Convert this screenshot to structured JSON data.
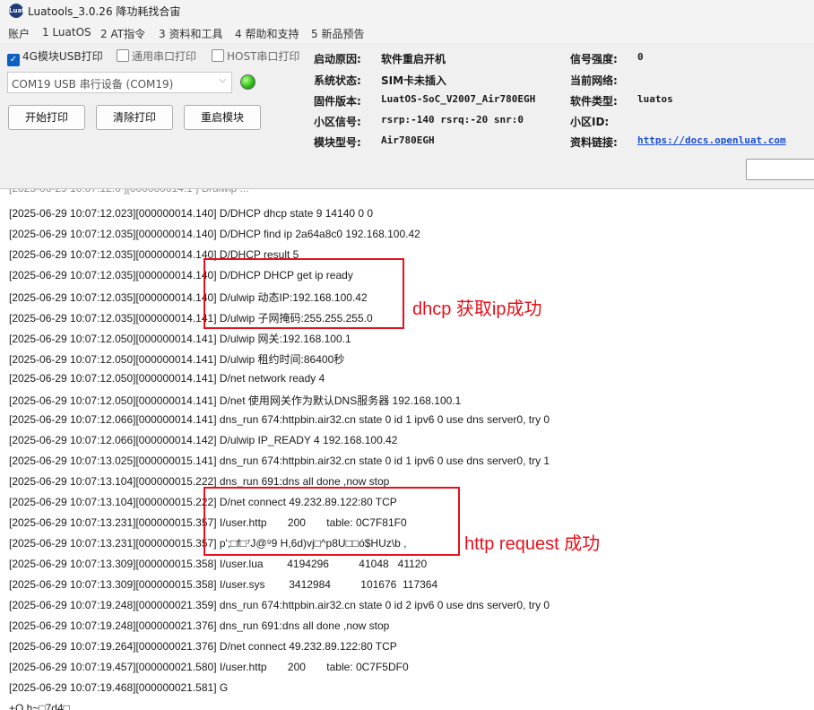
{
  "window": {
    "logo": "Luat",
    "title": "Luatools_3.0.26 降功耗找合宙"
  },
  "menu": [
    "账户",
    "1 LuatOS",
    "2 AT指令",
    "3 资料和工具",
    "4 帮助和支持",
    "5 新品预告"
  ],
  "checkboxes": [
    {
      "label": "4G模块USB打印",
      "checked": true
    },
    {
      "label": "通用串口打印",
      "checked": false
    },
    {
      "label": "HOST串口打印",
      "checked": false
    }
  ],
  "port_select": {
    "value": "COM19 USB 串行设备 (COM19)"
  },
  "status_led": {
    "color": "#2fbf1a"
  },
  "buttons": {
    "start_print": "开始打印",
    "clear_print": "清除打印",
    "restart_module": "重启模块"
  },
  "info": {
    "boot_reason_label": "启动原因:",
    "boot_reason_value": "软件重启开机",
    "system_status_label": "系统状态:",
    "system_status_value": "SIM卡未插入",
    "firmware_label": "固件版本:",
    "firmware_value": "LuatOS-SoC_V2007_Air780EGH",
    "cell_signal_label": "小区信号:",
    "cell_signal_value": "rsrp:-140 rsrq:-20 snr:0",
    "module_model_label": "模块型号:",
    "module_model_value": "Air780EGH",
    "signal_strength_label": "信号强度:",
    "signal_strength_value": "0",
    "network_label": "当前网络:",
    "network_value": "",
    "software_type_label": "软件类型:",
    "software_type_value": "luatos",
    "cell_id_label": "小区ID:",
    "cell_id_value": "",
    "docs_label": "资料链接:",
    "docs_value": "https://docs.openluat.com"
  },
  "search": {
    "placeholder": ""
  },
  "log": [
    "[2025-06-29 10:07:12.023][000000014.140] D/DHCP dhcp state 9 14140 0 0",
    "[2025-06-29 10:07:12.035][000000014.140] D/DHCP find ip 2a64a8c0 192.168.100.42",
    "[2025-06-29 10:07:12.035][000000014.140] D/DHCP result 5",
    "[2025-06-29 10:07:12.035][000000014.140] D/DHCP DHCP get ip ready",
    "[2025-06-29 10:07:12.035][000000014.140] D/ulwip 动态IP:192.168.100.42",
    "[2025-06-29 10:07:12.035][000000014.141] D/ulwip 子网掩码:255.255.255.0",
    "[2025-06-29 10:07:12.050][000000014.141] D/ulwip 网关:192.168.100.1",
    "[2025-06-29 10:07:12.050][000000014.141] D/ulwip 租约时间:86400秒",
    "[2025-06-29 10:07:12.050][000000014.141] D/net network ready 4",
    "[2025-06-29 10:07:12.050][000000014.141] D/net 使用网关作为默认DNS服务器 192.168.100.1",
    "[2025-06-29 10:07:12.066][000000014.141] dns_run 674:httpbin.air32.cn state 0 id 1 ipv6 0 use dns server0, try 0",
    "[2025-06-29 10:07:12.066][000000014.142] D/ulwip IP_READY 4 192.168.100.42",
    "[2025-06-29 10:07:13.025][000000015.141] dns_run 674:httpbin.air32.cn state 0 id 1 ipv6 0 use dns server0, try 1",
    "[2025-06-29 10:07:13.104][000000015.222] dns_run 691:dns all done ,now stop",
    "[2025-06-29 10:07:13.104][000000015.222] D/net connect 49.232.89.122:80 TCP",
    "[2025-06-29 10:07:13.231][000000015.357] I/user.http       200       table: 0C7F81F0",
    "[2025-06-29 10:07:13.231][000000015.357] p';□f□⁷J@⁹9 H,6d)vj□^p8U□□ó$HUz\\b ,",
    "[2025-06-29 10:07:13.309][000000015.358] I/user.lua        4194296          41048   41120",
    "[2025-06-29 10:07:13.309][000000015.358] I/user.sys        3412984          101676  117364",
    "[2025-06-29 10:07:19.248][000000021.359] dns_run 674:httpbin.air32.cn state 0 id 2 ipv6 0 use dns server0, try 0",
    "[2025-06-29 10:07:19.248][000000021.376] dns_run 691:dns all done ,now stop",
    "[2025-06-29 10:07:19.264][000000021.376] D/net connect 49.232.89.122:80 TCP",
    "[2025-06-29 10:07:19.457][000000021.580] I/user.http       200       table: 0C7F5DF0",
    "[2025-06-29 10:07:19.468][000000021.581] G",
    "+O h~□7d4□"
  ],
  "annotations": {
    "dhcp": "dhcp 获取ip成功",
    "http": "http request 成功",
    "color": "#e8101a"
  }
}
